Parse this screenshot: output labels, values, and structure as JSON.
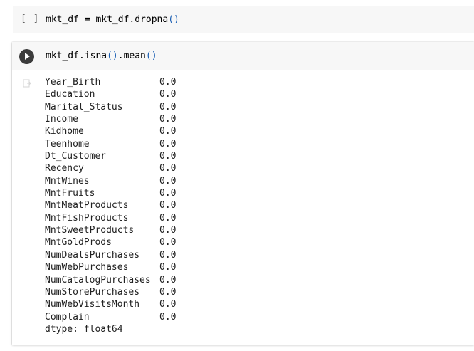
{
  "cell1": {
    "prompt": "[ ]",
    "code": {
      "prefix": "mkt_df = mkt_df.dropna",
      "parens": "()"
    }
  },
  "cell2": {
    "code": {
      "part1": "mkt_df.isna",
      "paren1": "()",
      "part2": ".mean",
      "paren2": "()"
    },
    "output": {
      "rows": [
        {
          "name": "Year_Birth",
          "value": "0.0"
        },
        {
          "name": "Education",
          "value": "0.0"
        },
        {
          "name": "Marital_Status",
          "value": "0.0"
        },
        {
          "name": "Income",
          "value": "0.0"
        },
        {
          "name": "Kidhome",
          "value": "0.0"
        },
        {
          "name": "Teenhome",
          "value": "0.0"
        },
        {
          "name": "Dt_Customer",
          "value": "0.0"
        },
        {
          "name": "Recency",
          "value": "0.0"
        },
        {
          "name": "MntWines",
          "value": "0.0"
        },
        {
          "name": "MntFruits",
          "value": "0.0"
        },
        {
          "name": "MntMeatProducts",
          "value": "0.0"
        },
        {
          "name": "MntFishProducts",
          "value": "0.0"
        },
        {
          "name": "MntSweetProducts",
          "value": "0.0"
        },
        {
          "name": "MntGoldProds",
          "value": "0.0"
        },
        {
          "name": "NumDealsPurchases",
          "value": "0.0"
        },
        {
          "name": "NumWebPurchases",
          "value": "0.0"
        },
        {
          "name": "NumCatalogPurchases",
          "value": "0.0"
        },
        {
          "name": "NumStorePurchases",
          "value": "0.0"
        },
        {
          "name": "NumWebVisitsMonth",
          "value": "0.0"
        },
        {
          "name": "Complain",
          "value": "0.0"
        }
      ],
      "dtype": "dtype: float64"
    }
  },
  "icons": {
    "run": "play-circle-icon",
    "output": "output-arrow-icon"
  },
  "colors": {
    "cell_bg": "#f7f7f7",
    "run_button": "#3c3c3c",
    "paren": "#1a5fb4"
  }
}
